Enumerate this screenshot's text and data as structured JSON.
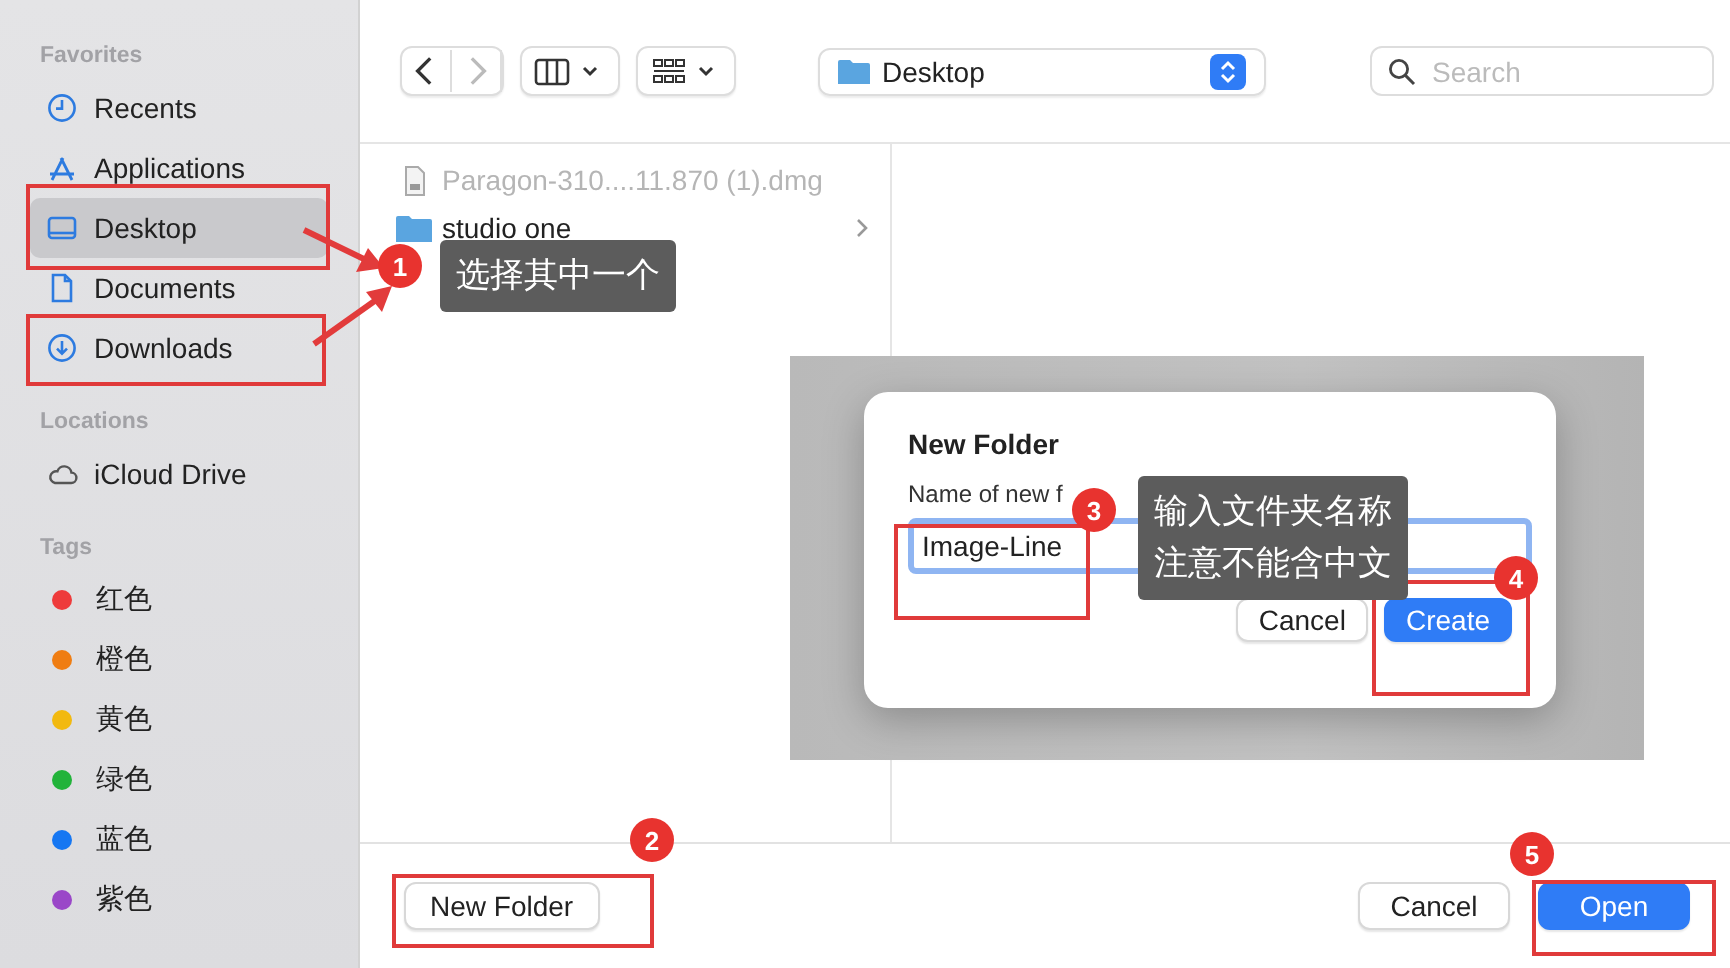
{
  "sidebar": {
    "sections": [
      {
        "title": "Favorites",
        "items": [
          {
            "label": "Recents",
            "selected": false
          },
          {
            "label": "Applications",
            "selected": false
          },
          {
            "label": "Desktop",
            "selected": true
          },
          {
            "label": "Documents",
            "selected": false
          },
          {
            "label": "Downloads",
            "selected": false
          }
        ]
      },
      {
        "title": "Locations",
        "items": [
          {
            "label": "iCloud Drive",
            "selected": false
          }
        ]
      },
      {
        "title": "Tags",
        "items": [
          {
            "label": "红色",
            "color": "#ee3b3b"
          },
          {
            "label": "橙色",
            "color": "#ef7d12"
          },
          {
            "label": "黄色",
            "color": "#f2b90f"
          },
          {
            "label": "绿色",
            "color": "#22b33a"
          },
          {
            "label": "蓝色",
            "color": "#1677f2"
          },
          {
            "label": "紫色",
            "color": "#9a47c8"
          }
        ]
      }
    ]
  },
  "toolbar": {
    "location": "Desktop",
    "search": {
      "placeholder": "Search"
    }
  },
  "files": [
    {
      "name": "Paragon-310....11.870 (1).dmg",
      "kind": "file",
      "disabled": true,
      "expandable": false
    },
    {
      "name": "studio one",
      "kind": "folder",
      "disabled": false,
      "expandable": true
    }
  ],
  "dialog": {
    "title": "New Folder",
    "label": "Name of new f",
    "value": "Image-Line",
    "buttons": [
      {
        "label": "Cancel",
        "primary": false
      },
      {
        "label": "Create",
        "primary": true
      }
    ]
  },
  "footer": {
    "left_buttons": [
      {
        "label": "New Folder",
        "primary": false
      }
    ],
    "right_buttons": [
      {
        "label": "Cancel",
        "primary": false
      },
      {
        "label": "Open",
        "primary": true
      }
    ]
  },
  "annotations": {
    "badges": [
      "1",
      "2",
      "3",
      "4",
      "5"
    ],
    "tooltips": [
      {
        "lines": [
          "选择其中一个"
        ]
      },
      {
        "lines": [
          "输入文件夹名称",
          "注意不能含中文"
        ]
      }
    ]
  }
}
